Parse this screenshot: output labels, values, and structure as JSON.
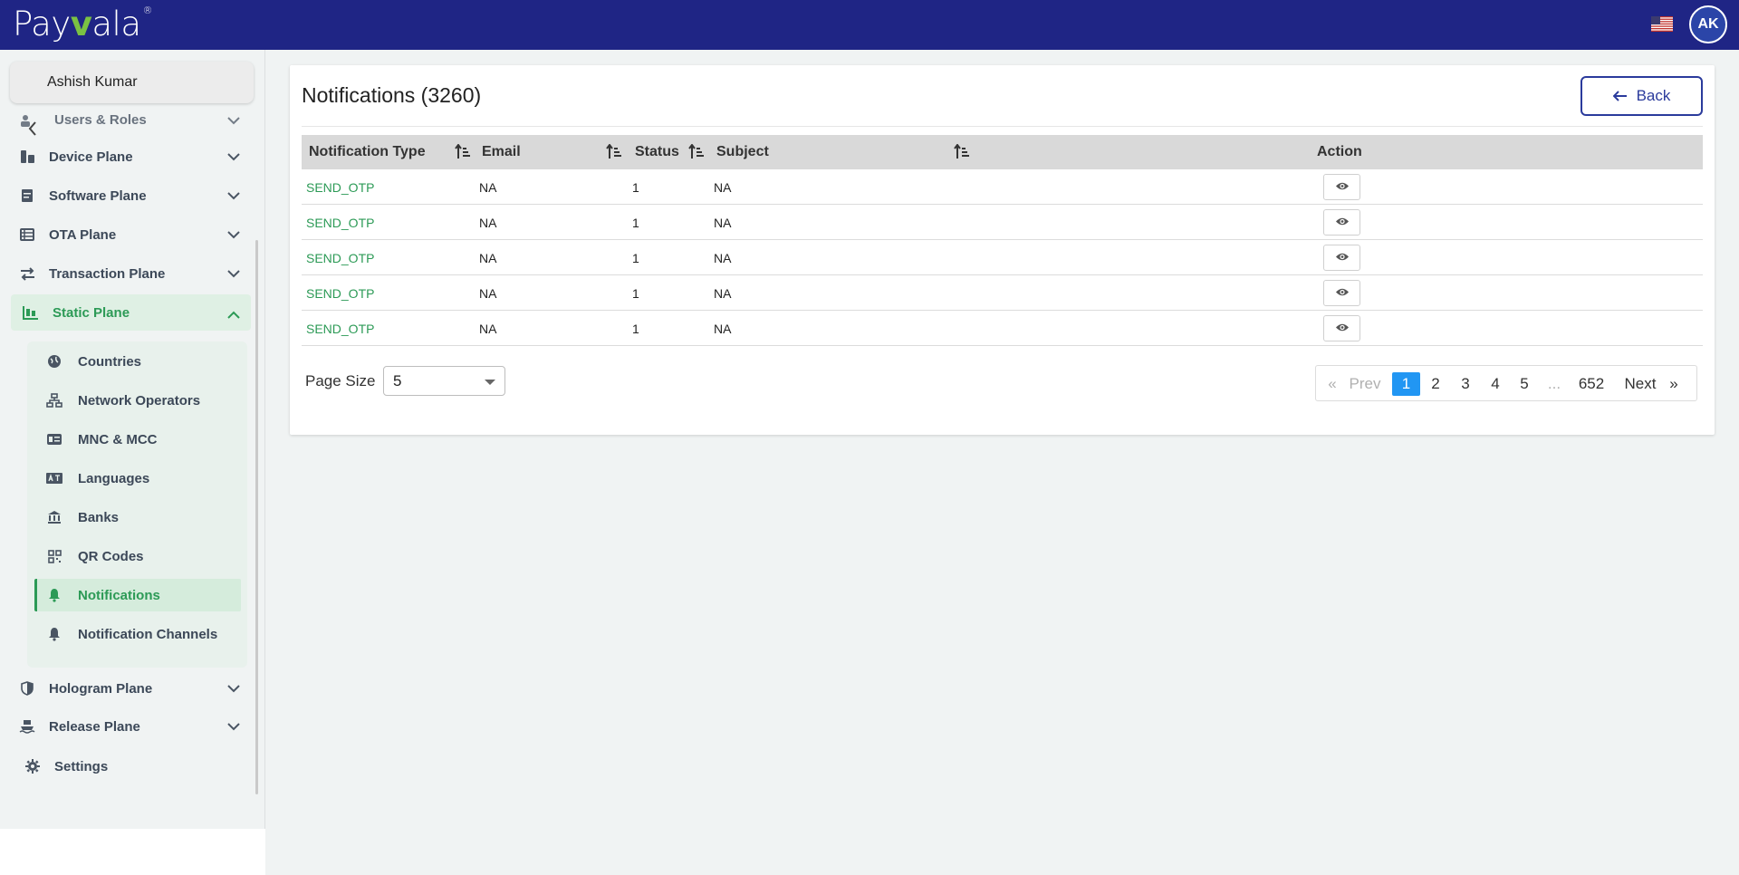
{
  "app": {
    "logo_text_a": "Pay",
    "logo_text_v": "v",
    "logo_text_b": "ala",
    "logo_reg": "®",
    "avatar_initials": "AK",
    "colors": {
      "topbar": "#1f2585",
      "accent_green": "#2c9a56",
      "pagination_active": "#2196f3"
    }
  },
  "sidebar": {
    "user_name": "Ashish Kumar",
    "items": [
      {
        "label": "Users & Roles",
        "icon": "users-roles-icon"
      },
      {
        "label": "Device Plane",
        "icon": "device-plane-icon"
      },
      {
        "label": "Software Plane",
        "icon": "software-plane-icon"
      },
      {
        "label": "OTA Plane",
        "icon": "ota-plane-icon"
      },
      {
        "label": "Transaction Plane",
        "icon": "transaction-plane-icon"
      },
      {
        "label": "Static Plane",
        "icon": "static-plane-icon"
      },
      {
        "label": "Hologram Plane",
        "icon": "hologram-plane-icon"
      },
      {
        "label": "Release Plane",
        "icon": "release-plane-icon"
      },
      {
        "label": "Settings",
        "icon": "gear-icon"
      }
    ],
    "static_sub": [
      {
        "label": "Countries",
        "icon": "globe-icon"
      },
      {
        "label": "Network Operators",
        "icon": "network-icon"
      },
      {
        "label": "MNC & MCC",
        "icon": "id-card-icon"
      },
      {
        "label": "Languages",
        "icon": "language-icon"
      },
      {
        "label": "Banks",
        "icon": "bank-icon"
      },
      {
        "label": "QR Codes",
        "icon": "qr-code-icon"
      },
      {
        "label": "Notifications",
        "icon": "bell-icon"
      },
      {
        "label": "Notification Channels",
        "icon": "bell-icon"
      }
    ]
  },
  "main": {
    "title": "Notifications (3260)",
    "back_label": "Back",
    "columns": [
      "Notification Type",
      "Email",
      "Status",
      "Subject",
      "Action"
    ],
    "rows": [
      {
        "type": "SEND_OTP",
        "email": "NA",
        "status": "1",
        "subject": "NA"
      },
      {
        "type": "SEND_OTP",
        "email": "NA",
        "status": "1",
        "subject": "NA"
      },
      {
        "type": "SEND_OTP",
        "email": "NA",
        "status": "1",
        "subject": "NA"
      },
      {
        "type": "SEND_OTP",
        "email": "NA",
        "status": "1",
        "subject": "NA"
      },
      {
        "type": "SEND_OTP",
        "email": "NA",
        "status": "1",
        "subject": "NA"
      }
    ],
    "page_size_label": "Page Size",
    "page_size_value": "5",
    "pagination": {
      "first": "«",
      "prev": "Prev",
      "pages": [
        "1",
        "2",
        "3",
        "4",
        "5"
      ],
      "ellipsis": "...",
      "last_page": "652",
      "next": "Next",
      "last": "»",
      "current": "1"
    }
  }
}
